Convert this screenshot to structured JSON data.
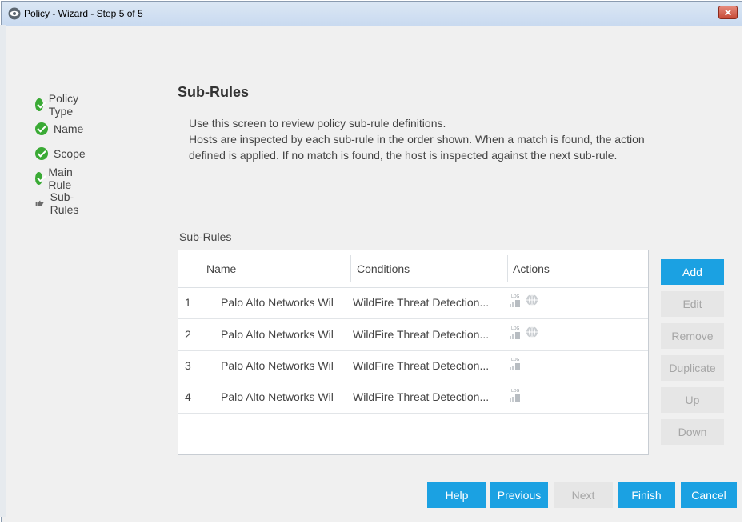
{
  "window": {
    "title": "Policy - Wizard - Step 5 of 5",
    "close_label": "✕"
  },
  "steps": [
    {
      "label": "Policy Type",
      "icon": "check-icon"
    },
    {
      "label": "Name",
      "icon": "check-icon"
    },
    {
      "label": "Scope",
      "icon": "check-icon"
    },
    {
      "label": "Main Rule",
      "icon": "check-icon"
    },
    {
      "label": "Sub-Rules",
      "icon": "hand-pointer-icon"
    }
  ],
  "main": {
    "heading": "Sub-Rules",
    "desc_line1": "Use this screen to review policy sub-rule definitions.",
    "desc_line2": "Hosts are inspected by each sub-rule in the order shown. When a match is found, the action",
    "desc_line3": "defined is applied. If no match is found, the host is inspected against the next sub-rule."
  },
  "table": {
    "label": "Sub-Rules",
    "columns": [
      "Name",
      "Conditions",
      "Actions"
    ],
    "rows": [
      {
        "num": "1",
        "name": "Palo Alto Networks Wil",
        "conditions": "WildFire Threat Detection...",
        "actions": [
          "log-icon",
          "globe-icon"
        ]
      },
      {
        "num": "2",
        "name": "Palo Alto Networks Wil",
        "conditions": "WildFire Threat Detection...",
        "actions": [
          "log-icon",
          "globe-icon"
        ]
      },
      {
        "num": "3",
        "name": "Palo Alto Networks Wil",
        "conditions": "WildFire Threat Detection...",
        "actions": [
          "log-icon"
        ]
      },
      {
        "num": "4",
        "name": "Palo Alto Networks Wil",
        "conditions": "WildFire Threat Detection...",
        "actions": [
          "log-icon"
        ]
      }
    ]
  },
  "side_buttons": {
    "add": "Add",
    "edit": "Edit",
    "remove": "Remove",
    "duplicate": "Duplicate",
    "up": "Up",
    "down": "Down"
  },
  "footer_buttons": {
    "help": "Help",
    "previous": "Previous",
    "next": "Next",
    "finish": "Finish",
    "cancel": "Cancel"
  },
  "colors": {
    "accent": "#1ba1e2",
    "check": "#3aaa35",
    "disabled_bg": "#e6e6e6",
    "disabled_text": "#a6a6a6"
  }
}
